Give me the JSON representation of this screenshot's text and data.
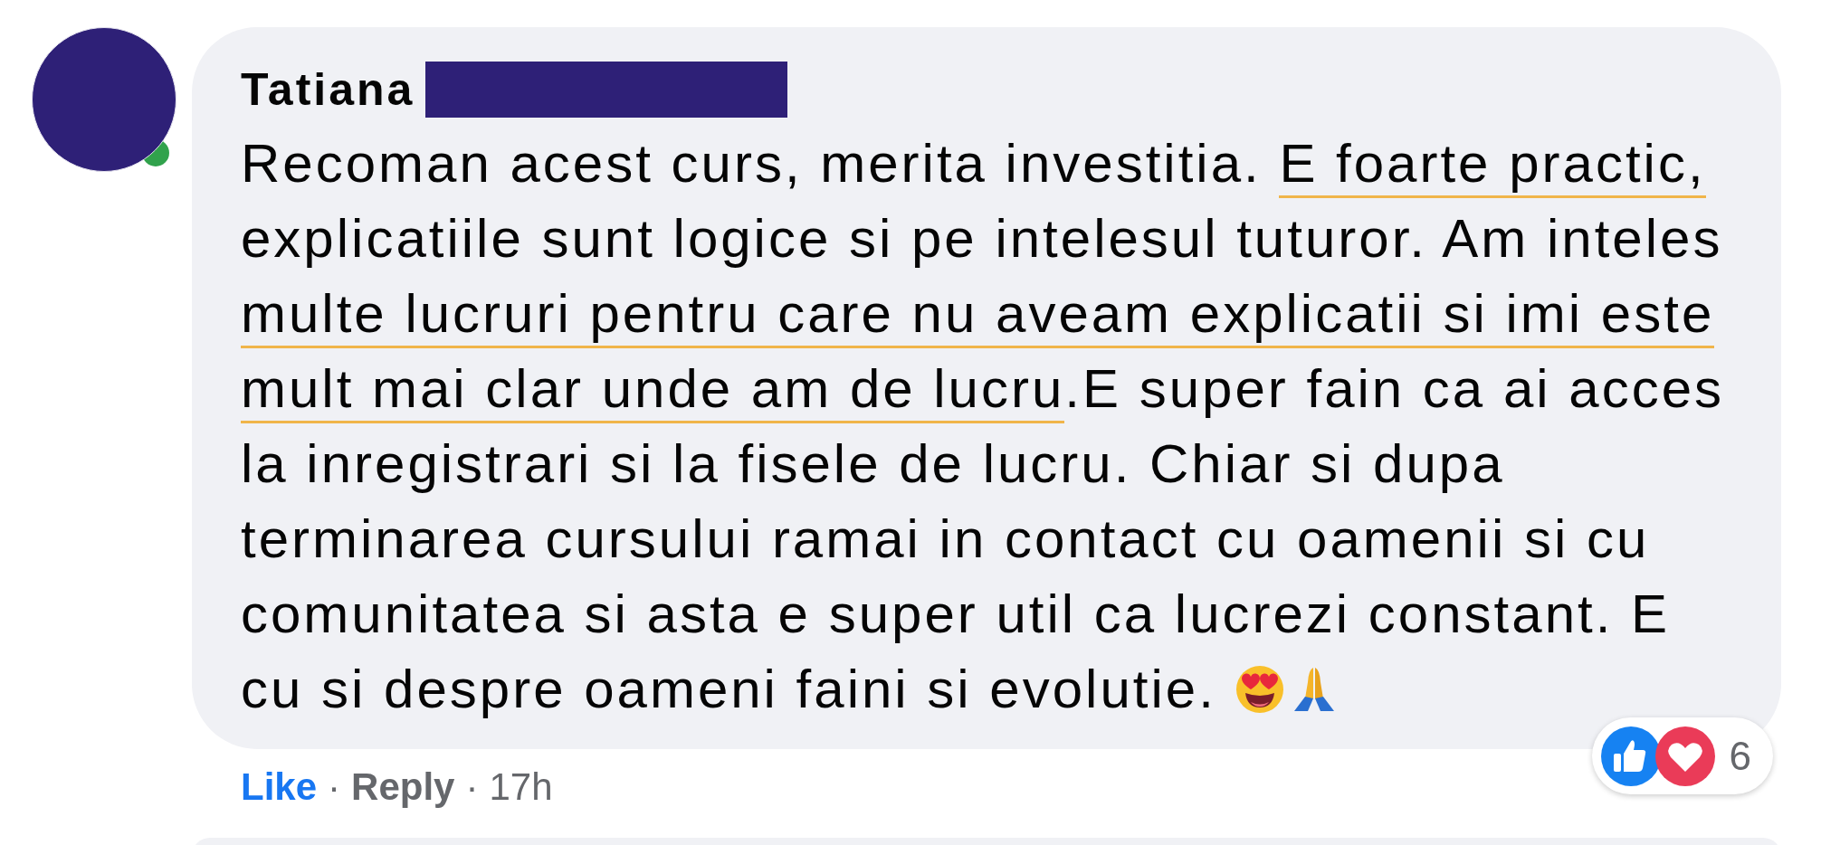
{
  "comment": {
    "author": {
      "name": "Tatiana",
      "online": true,
      "name_redacted": true
    },
    "body_lines": [
      [
        {
          "text": "Recoman acest curs, merita investitia. ",
          "underlined": false
        },
        {
          "text": "E foarte practic,",
          "underlined": true
        }
      ],
      [
        {
          "text": "explicatiile sunt logice si pe intelesul tuturor. Am inteles",
          "underlined": false
        }
      ],
      [
        {
          "text": "multe lucruri pentru care nu aveam explicatii si imi este",
          "underlined": true
        }
      ],
      [
        {
          "text": "mult mai clar unde am de lucru",
          "underlined": true
        },
        {
          "text": ".E super fain ca ai acces",
          "underlined": false
        }
      ],
      [
        {
          "text": "la inregistrari si la fisele de lucru. Chiar si dupa",
          "underlined": false
        }
      ],
      [
        {
          "text": "terminarea cursului ramai in contact cu oamenii si cu",
          "underlined": false
        }
      ],
      [
        {
          "text": "comunitatea si asta e super util ca lucrezi constant. E",
          "underlined": false
        }
      ],
      [
        {
          "text": "cu si despre oameni faini si evolutie. ",
          "underlined": false
        }
      ]
    ],
    "emojis": [
      {
        "kind": "heart-eyes"
      },
      {
        "kind": "praying-hands"
      }
    ],
    "actions": [
      {
        "label": "Like",
        "kind": "like"
      },
      {
        "label": "Reply",
        "kind": "reply"
      }
    ],
    "separator": "·",
    "time": "17h",
    "reactions": {
      "types": [
        {
          "kind": "like"
        },
        {
          "kind": "love"
        }
      ],
      "count": "6"
    }
  }
}
